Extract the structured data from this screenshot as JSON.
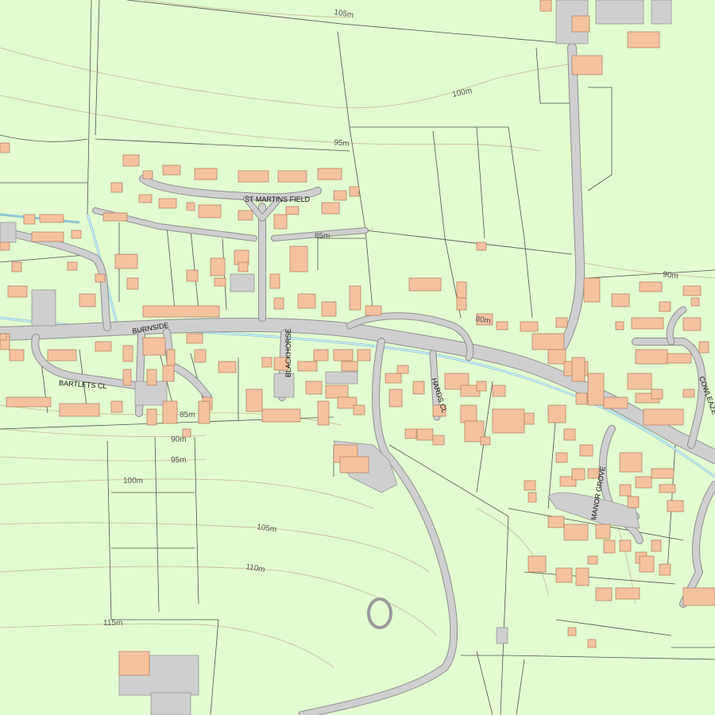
{
  "map": {
    "colors": {
      "land": "#e2fbd0",
      "building": "#f5c2a0",
      "road": "#cfcfcf",
      "water": "#8ec6d6",
      "contour": "#c9b98f",
      "boundary": "#505050"
    },
    "streets": {
      "st_martins_field": "ST MARTINS FIELD",
      "burnside": "BURNSIDE",
      "bartlets_cl": "BARTLETS CL",
      "blackhorse": "BLACKHORSE",
      "hards_close": "HARDS CL",
      "manor_grove": "MANOR GROVE",
      "cowleaze": "COWLEAZE"
    },
    "contours": {
      "c105_top": "105m",
      "c100_top": "100m",
      "c95_top": "95m",
      "c85_mid": "85m",
      "c90_right": "90m",
      "c80_mid": "80m",
      "c85_left": "85m",
      "c90_left": "90m",
      "c95_left": "95m",
      "c100_left": "100m",
      "c105_bottom": "105m",
      "c110_bottom": "110m",
      "c115_bottom": "115m"
    }
  }
}
